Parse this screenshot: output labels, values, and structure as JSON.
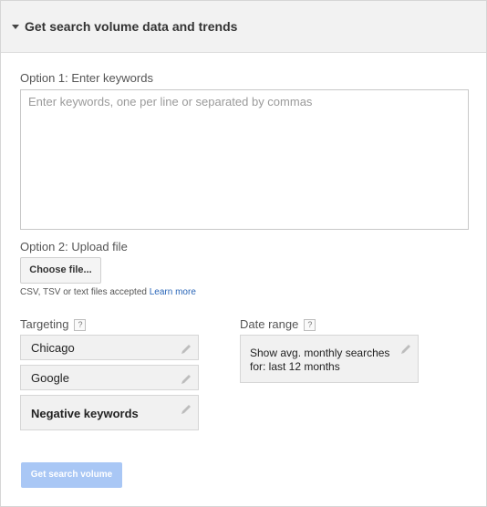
{
  "header": {
    "title": "Get search volume data and trends"
  },
  "option1": {
    "label": "Option 1: Enter keywords",
    "placeholder": "Enter keywords, one per line or separated by commas",
    "value": ""
  },
  "option2": {
    "label": "Option 2: Upload file",
    "choose_button": "Choose file...",
    "help_text": "CSV, TSV or text files accepted",
    "learn_more": "Learn more"
  },
  "targeting": {
    "label": "Targeting",
    "help_icon": "?",
    "items": [
      {
        "label": "Chicago"
      },
      {
        "label": "Google"
      },
      {
        "label": "Negative keywords"
      }
    ]
  },
  "date_range": {
    "label": "Date range",
    "help_icon": "?",
    "value": "Show avg. monthly searches for: last 12 months"
  },
  "actions": {
    "get_volume_label": "Get search volume",
    "get_volume_color": "#a9c7f5"
  },
  "icons": {
    "collapse": "caret-down-icon",
    "edit": "pencil-icon",
    "help": "question-mark-icon"
  }
}
